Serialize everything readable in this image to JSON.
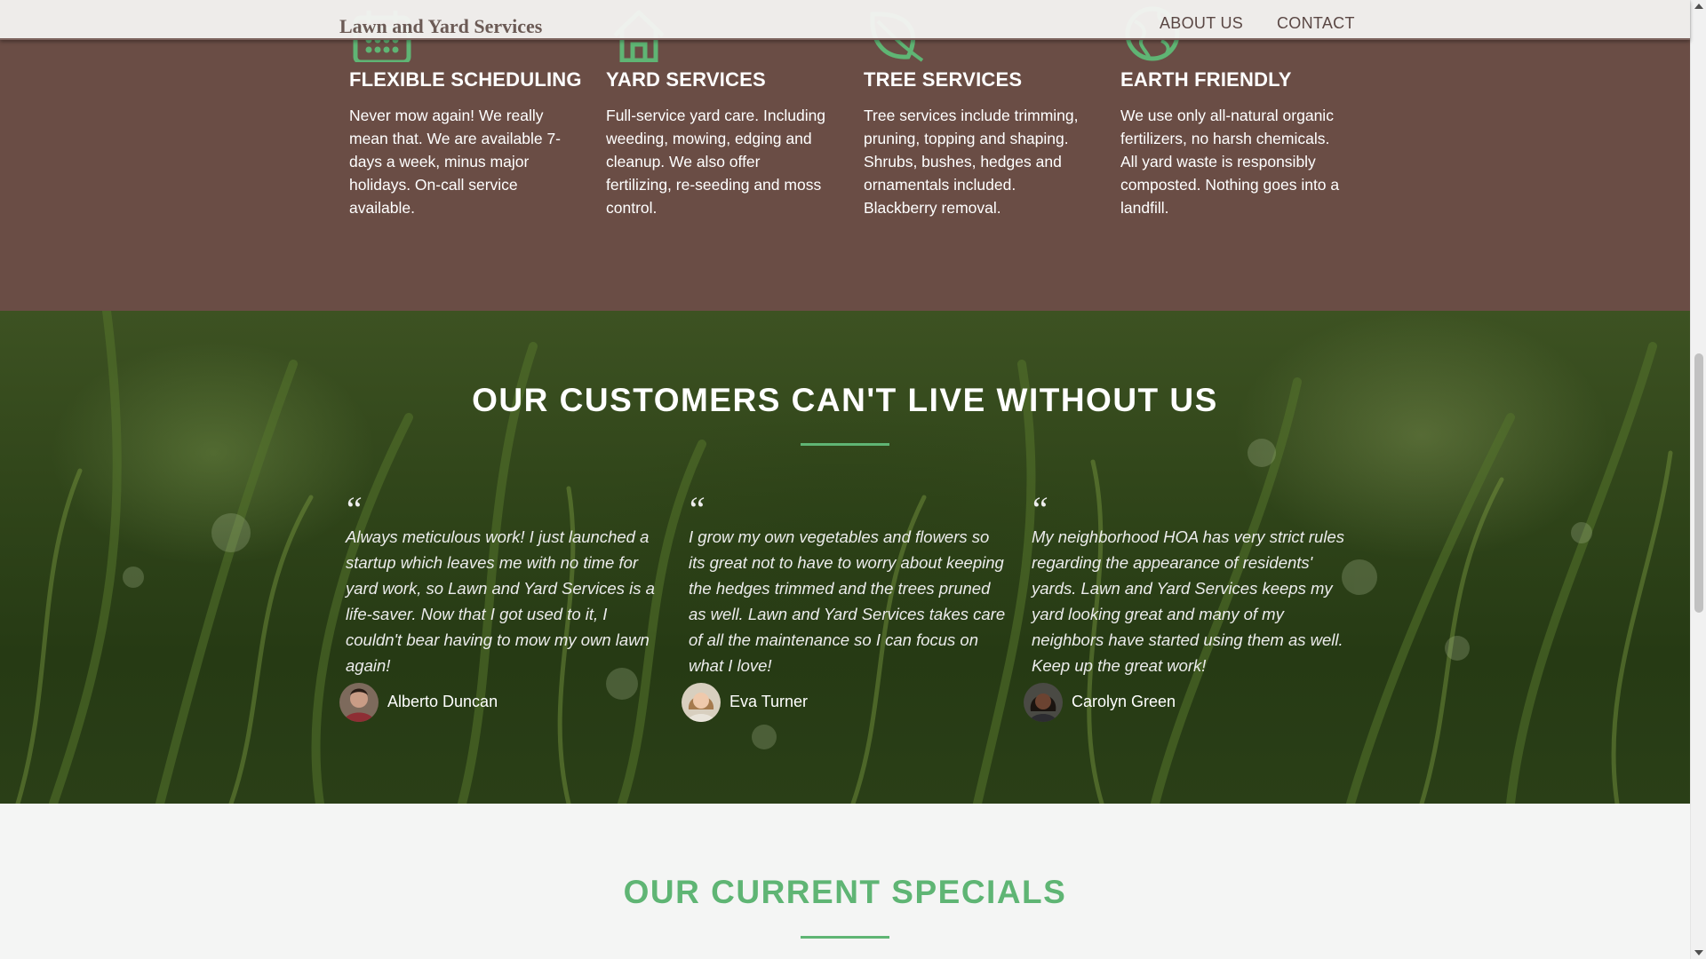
{
  "header": {
    "brand": "Lawn and Yard Services",
    "nav": [
      {
        "label": "ABOUT US"
      },
      {
        "label": "CONTACT"
      }
    ]
  },
  "services": [
    {
      "icon": "calendar-icon",
      "title": "FLEXIBLE SCHEDULING",
      "text": "Never mow again! We really mean that. We are available 7-days a week, minus major holidays. On-call service available."
    },
    {
      "icon": "house-icon",
      "title": "YARD SERVICES",
      "text": "Full-service yard care. Including weeding, mowing, edging and cleanup. We also offer fertilizing, re-seeding and moss control."
    },
    {
      "icon": "leaf-icon",
      "title": "TREE SERVICES",
      "text": "Tree services include trimming, pruning, topping and shaping. Shrubs, bushes, hedges and ornamentals included. Blackberry removal."
    },
    {
      "icon": "globe-icon",
      "title": "EARTH FRIENDLY",
      "text": "We use only all-natural organic fertilizers, no harsh chemicals. All yard waste is responsibly composted. Nothing goes into a landfill."
    }
  ],
  "testimonials": {
    "title": "OUR CUSTOMERS CAN'T LIVE WITHOUT US",
    "items": [
      {
        "quote_mark": "“",
        "text": "Always meticulous work! I just launched a startup which leaves me with no time for yard work, so Lawn and Yard Services is a life-saver. Now that I got used to it, I couldn't bear having to mow my own lawn again!",
        "name": "Alberto Duncan"
      },
      {
        "quote_mark": "“",
        "text": "I grow my own vegetables and flowers so its great not to have to worry about keeping the hedges trimmed and the trees pruned as well. Lawn and Yard Services takes care of all the maintenance so I can focus on what I love!",
        "name": "Eva Turner"
      },
      {
        "quote_mark": "“",
        "text": "My neighborhood HOA has very strict rules regarding the appearance of residents' yards. Lawn and Yard Services keeps my yard looking great and many of my neighbors have started using them as well. Keep up the great work!",
        "name": "Carolyn Green"
      }
    ]
  },
  "specials": {
    "title": "OUR CURRENT SPECIALS"
  },
  "colors": {
    "accent_green": "#5fb574",
    "band_brown": "#6a4d45",
    "brand_text": "#6b5a55"
  }
}
